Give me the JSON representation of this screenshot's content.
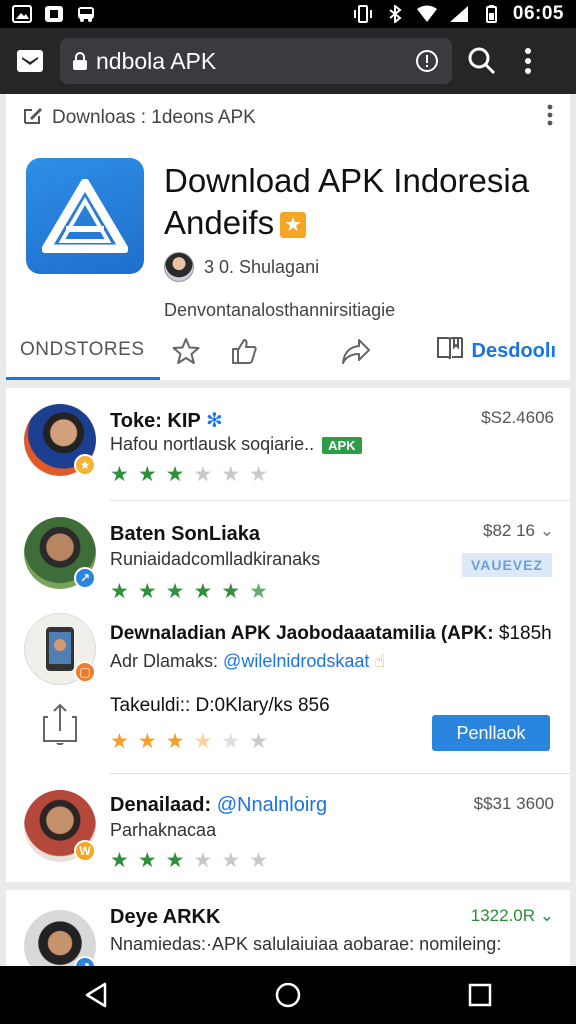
{
  "status_bar": {
    "time": "06:05",
    "left_icons": [
      "image-icon",
      "app-icon",
      "car-icon"
    ],
    "right_icons": [
      "vibrate-icon",
      "bluetooth-icon",
      "wifi-icon",
      "signal-icon",
      "battery-icon"
    ]
  },
  "browser": {
    "url": "ndbola APK",
    "icons": [
      "tabs-icon",
      "lock-icon",
      "info-icon",
      "search-icon",
      "more-vert-icon"
    ]
  },
  "page": {
    "breadcrumb": "Downloas : 1deons APK",
    "app_title_line1": "Download APK Indoresia",
    "app_title_line2": "Andeifs",
    "author": "3 0. Shulagani",
    "description": "Denvontanalosthannirsitiagie",
    "tab_label": "ONDSTORES",
    "download_label": "Desdoolı"
  },
  "list": [
    {
      "title": "Toke: KIP",
      "subtitle": "Hafou nortlausk soqiarie..",
      "tag": "APK",
      "price": "$S2.4606",
      "rating": 3,
      "rating_color": "green",
      "badge_color": "#f5b335"
    },
    {
      "title": "Baten SonLiaka",
      "subtitle": "Runiaidadcomlladkiranaks",
      "price": "$82 16",
      "chip": "VAUEVEZ",
      "rating": 4.5,
      "rating_color": "green",
      "badge_color": "#2a85de"
    },
    {
      "title": "Dewnaladian APK Jaobodaaatamilia (APK:",
      "title_suffix": "$185h",
      "subtitle_prefix": "Adr Dlamaks:",
      "subtitle_handle": "@wilelnidrodskaat",
      "badge_color": "#f07b29"
    },
    {
      "title": "Takeuldi:: D:0Klary/ks 856",
      "button_label": "Penllaok",
      "rating": 3.5,
      "rating_color": "orange"
    },
    {
      "title": "Denailaad:",
      "title_handle": "@Nnalnloirg",
      "subtitle": "Parhaknacaa",
      "price": "$$31 3600",
      "rating": 3,
      "rating_color": "green",
      "badge_color": "#f5a623"
    },
    {
      "title": "Deye ARKK",
      "subtitle": "Nnamiedas:·APK salulaiuiaa aobarae: nomileing:",
      "price": "1322.0R",
      "badge_color": "#2a85de"
    }
  ],
  "nav_icons": [
    "back-icon",
    "home-icon",
    "recents-icon"
  ]
}
